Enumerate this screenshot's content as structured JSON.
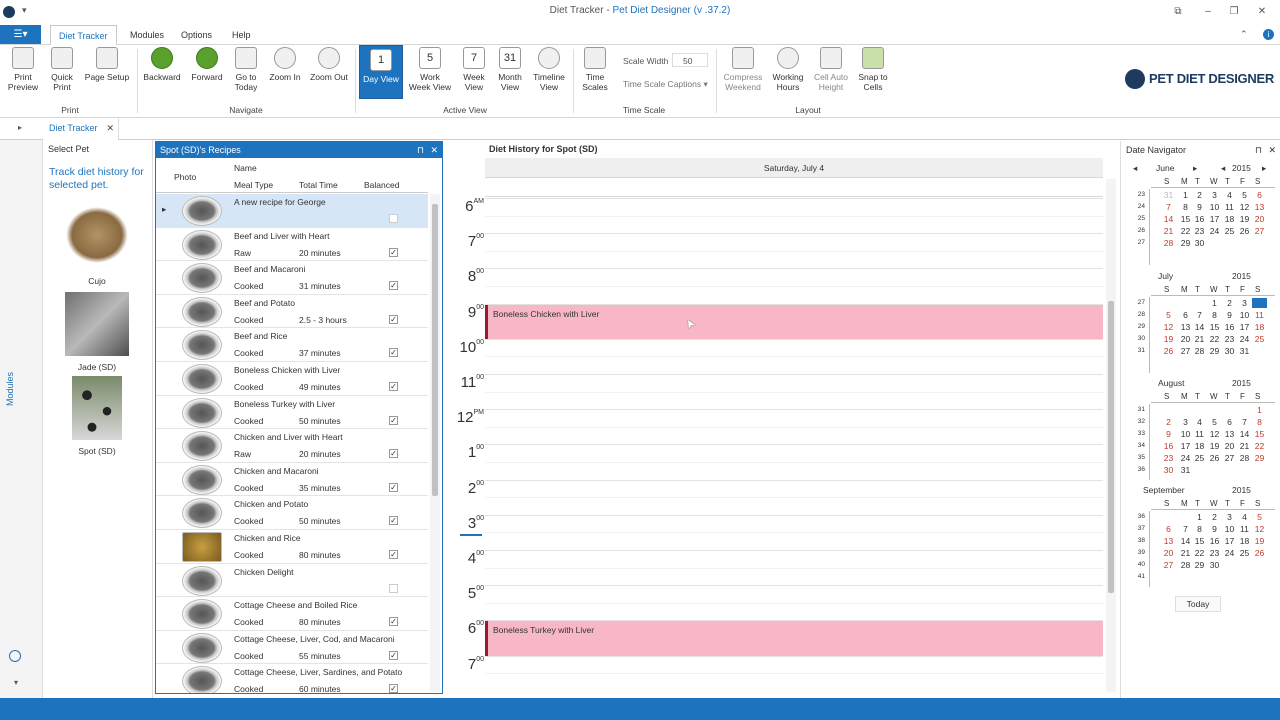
{
  "window": {
    "title": "Diet Tracker",
    "title_sep": " - ",
    "app_name": "Pet Diet Designer",
    "version": "(v .37.2)"
  },
  "menu": {
    "tabs": [
      "Diet Tracker",
      "Modules",
      "Options",
      "Help"
    ]
  },
  "ribbon": {
    "print": {
      "buttons": [
        "Print\nPreview",
        "Quick\nPrint",
        "Page Setup"
      ],
      "group": "Print"
    },
    "navigate": {
      "buttons": [
        "Backward",
        "Forward",
        "Go to\nToday",
        "Zoom In",
        "Zoom Out"
      ],
      "group": "Navigate"
    },
    "active_view": {
      "buttons": [
        "Day View",
        "Work\nWeek View",
        "Week\nView",
        "Month\nView",
        "Timeline\nView"
      ],
      "group": "Active View",
      "icon_nums": [
        "1",
        "5",
        "7",
        "31"
      ]
    },
    "time_scale": {
      "buttons": [
        "Time\nScales"
      ],
      "scale_width_label": "Scale Width",
      "scale_width_value": "50",
      "captions_label": "Time Scale Captions",
      "group": "Time Scale"
    },
    "layout": {
      "buttons": [
        "Compress\nWeekend",
        "Working\nHours",
        "Cell Auto\nHeight",
        "Snap to\nCells"
      ],
      "group": "Layout"
    },
    "logo": "PET DIET DESIGNER"
  },
  "doc_tab": "Diet Tracker",
  "left_nav": {
    "label": "Modules"
  },
  "select_pet": {
    "title": "Select Pet",
    "hint": "Track diet history for selected pet.",
    "pets": [
      "Cujo",
      "Jade (SD)",
      "Spot (SD)"
    ]
  },
  "recipes": {
    "title": "Spot (SD)'s Recipes",
    "col_photo": "Photo",
    "col_name": "Name",
    "col_meal": "Meal Type",
    "col_time": "Total Time",
    "col_bal": "Balanced",
    "rows": [
      {
        "name": "A new recipe for George",
        "meal": "",
        "time": "",
        "bal": false
      },
      {
        "name": "Beef and Liver with Heart",
        "meal": "Raw",
        "time": "20 minutes",
        "bal": true
      },
      {
        "name": "Beef and Macaroni",
        "meal": "Cooked",
        "time": "31 minutes",
        "bal": true
      },
      {
        "name": "Beef and Potato",
        "meal": "Cooked",
        "time": "2.5 - 3 hours",
        "bal": true
      },
      {
        "name": "Beef and Rice",
        "meal": "Cooked",
        "time": "37 minutes",
        "bal": true
      },
      {
        "name": "Boneless Chicken with Liver",
        "meal": "Cooked",
        "time": "49 minutes",
        "bal": true
      },
      {
        "name": "Boneless Turkey with Liver",
        "meal": "Cooked",
        "time": "50 minutes",
        "bal": true
      },
      {
        "name": "Chicken and Liver with Heart",
        "meal": "Raw",
        "time": "20 minutes",
        "bal": true
      },
      {
        "name": "Chicken and Macaroni",
        "meal": "Cooked",
        "time": "35 minutes",
        "bal": true
      },
      {
        "name": "Chicken and Potato",
        "meal": "Cooked",
        "time": "50 minutes",
        "bal": true
      },
      {
        "name": "Chicken and Rice",
        "meal": "Cooked",
        "time": "80 minutes",
        "bal": true
      },
      {
        "name": "Chicken Delight",
        "meal": "",
        "time": "",
        "bal": false
      },
      {
        "name": "Cottage Cheese and Boiled Rice",
        "meal": "Cooked",
        "time": "80 minutes",
        "bal": true
      },
      {
        "name": "Cottage Cheese, Liver, Cod, and Macaroni",
        "meal": "Cooked",
        "time": "55 minutes",
        "bal": true
      },
      {
        "name": "Cottage Cheese, Liver, Sardines, and Potato",
        "meal": "Cooked",
        "time": "60 minutes",
        "bal": true
      }
    ]
  },
  "history": {
    "title": "Diet History for Spot (SD)",
    "day": "Saturday, July 4",
    "hours": [
      [
        "6",
        "AM"
      ],
      [
        "7",
        "00"
      ],
      [
        "8",
        "00"
      ],
      [
        "9",
        "00"
      ],
      [
        "10",
        "00"
      ],
      [
        "11",
        "00"
      ],
      [
        "12",
        "PM"
      ],
      [
        "1",
        "00"
      ],
      [
        "2",
        "00"
      ],
      [
        "3",
        "00"
      ],
      [
        "4",
        "00"
      ],
      [
        "5",
        "00"
      ],
      [
        "6",
        "00"
      ],
      [
        "7",
        "00"
      ]
    ],
    "appointments": [
      {
        "label": "Boneless Chicken with Liver"
      },
      {
        "label": "Boneless Turkey with Liver"
      }
    ]
  },
  "date_nav": {
    "title": "Date Navigator",
    "year": "2015",
    "days": [
      "S",
      "M",
      "T",
      "W",
      "T",
      "F",
      "S"
    ],
    "today_btn": "Today",
    "months": [
      {
        "name": "June",
        "weeks": [
          "23",
          "24",
          "25",
          "26",
          "27"
        ],
        "start": 1,
        "count": 30,
        "prev_tail": [
          "31"
        ],
        "sel": null
      },
      {
        "name": "July",
        "weeks": [
          "27",
          "28",
          "29",
          "30",
          "31"
        ],
        "start": 3,
        "count": 31,
        "prev_tail": [],
        "sel": 4
      },
      {
        "name": "August",
        "weeks": [
          "31",
          "32",
          "33",
          "34",
          "35",
          "36"
        ],
        "start": 6,
        "count": 31,
        "prev_tail": [],
        "sel": null
      },
      {
        "name": "September",
        "weeks": [
          "36",
          "37",
          "38",
          "39",
          "40",
          "41"
        ],
        "start": 2,
        "count": 30,
        "prev_tail": [],
        "sel": null
      }
    ]
  },
  "colors": {
    "accent": "#1e73be",
    "appointment": "#f7b7c6",
    "appointment_border": "#9c1a2e",
    "weekend": "#c0392b"
  }
}
